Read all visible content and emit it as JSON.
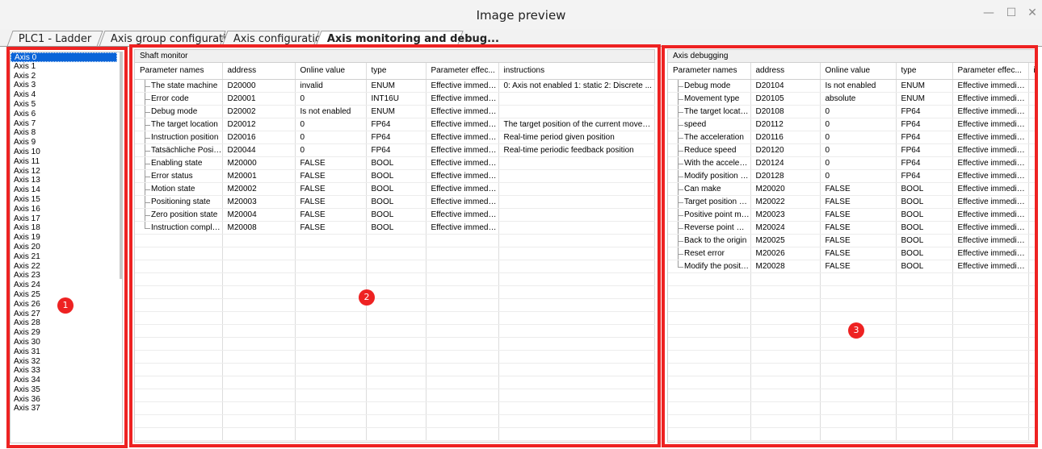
{
  "window": {
    "title": "Image preview",
    "controls": {
      "minimize": "—",
      "maximize": "☐",
      "close": "✕"
    }
  },
  "tabs": [
    {
      "label": "PLC1 - Ladder",
      "active": false
    },
    {
      "label": "Axis group configuration",
      "active": false
    },
    {
      "label": "Axis configuration",
      "active": false
    },
    {
      "label": "Axis monitoring and debug...",
      "active": true
    }
  ],
  "axes": [
    "Axis 0",
    "Axis 1",
    "Axis 2",
    "Axis 3",
    "Axis 4",
    "Axis 5",
    "Axis 6",
    "Axis 7",
    "Axis 8",
    "Axis 9",
    "Axis 10",
    "Axis 11",
    "Axis 12",
    "Axis 13",
    "Axis 14",
    "Axis 15",
    "Axis 16",
    "Axis 17",
    "Axis 18",
    "Axis 19",
    "Axis 20",
    "Axis 21",
    "Axis 22",
    "Axis 23",
    "Axis 24",
    "Axis 25",
    "Axis 26",
    "Axis 27",
    "Axis 28",
    "Axis 29",
    "Axis 30",
    "Axis 31",
    "Axis 32",
    "Axis 33",
    "Axis 34",
    "Axis 35",
    "Axis 36",
    "Axis 37"
  ],
  "selected_axis": "Axis 0",
  "shaft_monitor": {
    "title": "Shaft monitor",
    "columns": [
      "Parameter names",
      "address",
      "Online value",
      "type",
      "Parameter effec...",
      "instructions"
    ],
    "rows": [
      [
        "The state machine",
        "D20000",
        "invalid",
        "ENUM",
        "Effective immedia...",
        "0: Axis not enabled 1: static 2: Discrete ..."
      ],
      [
        "Error code",
        "D20001",
        "0",
        "INT16U",
        "Effective immedia...",
        ""
      ],
      [
        "Debug mode",
        "D20002",
        "Is not enabled",
        "ENUM",
        "Effective immedia...",
        ""
      ],
      [
        "The target location",
        "D20012",
        "0",
        "FP64",
        "Effective immedia...",
        "The target position of the current movem..."
      ],
      [
        "Instruction position",
        "D20016",
        "0",
        "FP64",
        "Effective immedia...",
        "Real-time period given position"
      ],
      [
        "Tatsächliche Posit...",
        "D20044",
        "0",
        "FP64",
        "Effective immedia...",
        "Real-time periodic feedback position"
      ],
      [
        "Enabling state",
        "M20000",
        "FALSE",
        "BOOL",
        "Effective immedia...",
        ""
      ],
      [
        "Error status",
        "M20001",
        "FALSE",
        "BOOL",
        "Effective immedia...",
        ""
      ],
      [
        "Motion state",
        "M20002",
        "FALSE",
        "BOOL",
        "Effective immedia...",
        ""
      ],
      [
        "Positioning state",
        "M20003",
        "FALSE",
        "BOOL",
        "Effective immedia...",
        ""
      ],
      [
        "Zero position state",
        "M20004",
        "FALSE",
        "BOOL",
        "Effective immedia...",
        ""
      ],
      [
        "Instruction comple...",
        "M20008",
        "FALSE",
        "BOOL",
        "Effective immedia...",
        ""
      ]
    ]
  },
  "axis_debugging": {
    "title": "Axis debugging",
    "columns": [
      "Parameter names",
      "address",
      "Online value",
      "type",
      "Parameter effec...",
      "in"
    ],
    "rows": [
      [
        "Debug mode",
        "D20104",
        "Is not enabled",
        "ENUM",
        "Effective immedia..."
      ],
      [
        "Movement type",
        "D20105",
        "absolute",
        "ENUM",
        "Effective immedia..."
      ],
      [
        "The target location",
        "D20108",
        "0",
        "FP64",
        "Effective immedia..."
      ],
      [
        "speed",
        "D20112",
        "0",
        "FP64",
        "Effective immedia..."
      ],
      [
        "The acceleration",
        "D20116",
        "0",
        "FP64",
        "Effective immedia..."
      ],
      [
        "Reduce speed",
        "D20120",
        "0",
        "FP64",
        "Effective immedia..."
      ],
      [
        "With the accelerat...",
        "D20124",
        "0",
        "FP64",
        "Effective immedia..."
      ],
      [
        "Modify position va...",
        "D20128",
        "0",
        "FP64",
        "Effective immedia..."
      ],
      [
        "Can make",
        "M20020",
        "FALSE",
        "BOOL",
        "Effective immedia..."
      ],
      [
        "Target position mo...",
        "M20022",
        "FALSE",
        "BOOL",
        "Effective immedia..."
      ],
      [
        "Positive point move",
        "M20023",
        "FALSE",
        "BOOL",
        "Effective immedia..."
      ],
      [
        "Reverse point move",
        "M20024",
        "FALSE",
        "BOOL",
        "Effective immedia..."
      ],
      [
        "Back to the origin",
        "M20025",
        "FALSE",
        "BOOL",
        "Effective immedia..."
      ],
      [
        "Reset error",
        "M20026",
        "FALSE",
        "BOOL",
        "Effective immedia..."
      ],
      [
        "Modify the position",
        "M20028",
        "FALSE",
        "BOOL",
        "Effective immedia..."
      ]
    ]
  },
  "annotations": {
    "badges": [
      "1",
      "2",
      "3"
    ],
    "color": "#ee2222"
  }
}
